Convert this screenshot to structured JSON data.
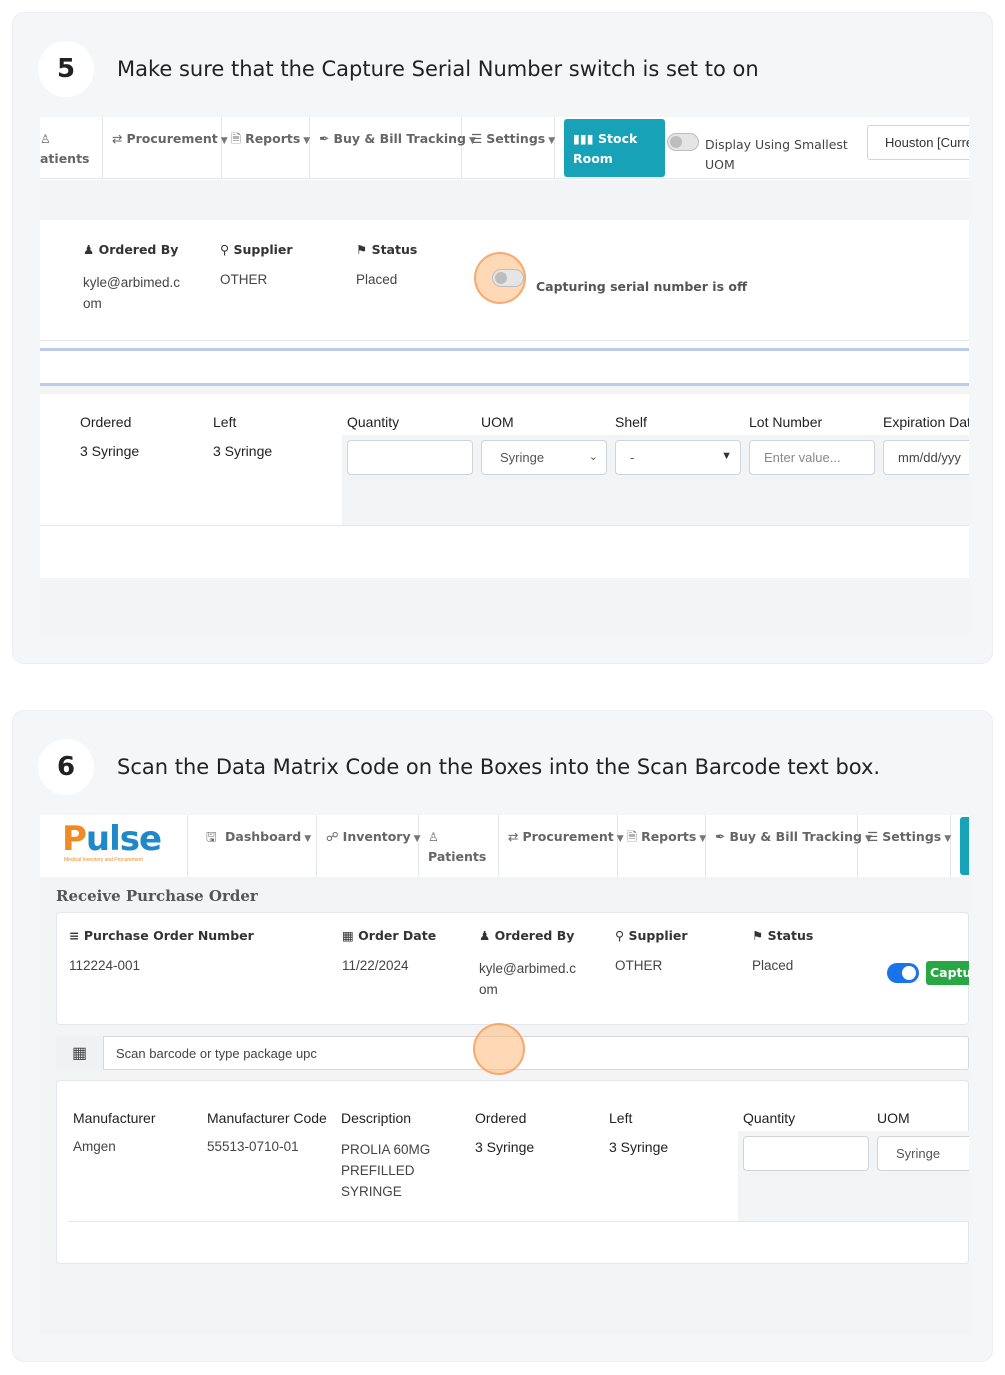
{
  "step5": {
    "number": "5",
    "instruction": "Make sure that the Capture Serial Number switch is set to on",
    "nav": {
      "patients_partial": "atients",
      "procurement": "Procurement",
      "reports": "Reports",
      "buy_bill": "Buy & Bill Tracking",
      "settings": "Settings",
      "stock_room": "Stock Room",
      "display_smallest_uom_1": "Display Using Smallest",
      "display_smallest_uom_2": "UOM",
      "location": "Houston [Curre"
    },
    "order": {
      "ordered_by_label": "Ordered By",
      "ordered_by_value_1": "kyle@arbimed.c",
      "ordered_by_value_2": "om",
      "supplier_label": "Supplier",
      "supplier_value": "OTHER",
      "status_label": "Status",
      "status_value": "Placed",
      "serial_toggle_text": "Capturing serial number is off"
    },
    "table": {
      "headers": [
        "Ordered",
        "Left",
        "Quantity",
        "UOM",
        "Shelf",
        "Lot Number",
        "Expiration Dat"
      ],
      "ordered": "3 Syringe",
      "left": "3 Syringe",
      "uom_selected": "Syringe",
      "shelf_selected": "-",
      "lot_placeholder": "Enter value...",
      "expiration_placeholder": "mm/dd/yyy"
    }
  },
  "step6": {
    "number": "6",
    "instruction": "Scan the Data Matrix Code on the Boxes into the Scan Barcode text box.",
    "logo": {
      "text": "Pulse",
      "tagline": "Medical Inventory and Procurement"
    },
    "nav": {
      "dashboard": "Dashboard",
      "inventory": "Inventory",
      "patients": "Patients",
      "procurement": "Procurement",
      "reports": "Reports",
      "buy_bill": "Buy & Bill Tracking",
      "settings": "Settings"
    },
    "page_title": "Receive Purchase Order",
    "order": {
      "po_label": "Purchase Order Number",
      "po_value": "112224-001",
      "date_label": "Order Date",
      "date_value": "11/22/2024",
      "ordered_by_label": "Ordered By",
      "ordered_by_value_1": "kyle@arbimed.c",
      "ordered_by_value_2": "om",
      "supplier_label": "Supplier",
      "supplier_value": "OTHER",
      "status_label": "Status",
      "status_value": "Placed",
      "capture_button": "Captur"
    },
    "scan": {
      "placeholder": "Scan barcode or type package upc"
    },
    "table": {
      "headers": [
        "Manufacturer",
        "Manufacturer Code",
        "Description",
        "Ordered",
        "Left",
        "Quantity",
        "UOM"
      ],
      "manufacturer": "Amgen",
      "code": "55513-0710-01",
      "description_1": "PROLIA 60MG",
      "description_2": "PREFILLED",
      "description_3": "SYRINGE",
      "ordered": "3 Syringe",
      "left": "3 Syringe",
      "uom_selected": "Syringe"
    }
  },
  "colors": {
    "accent_teal": "#17a2b8",
    "brand_orange": "#f08a24",
    "brand_blue": "#1e88c9",
    "toggle_on": "#1a73e8",
    "capture_green": "#28a745",
    "highlight": "#f9b98a"
  }
}
